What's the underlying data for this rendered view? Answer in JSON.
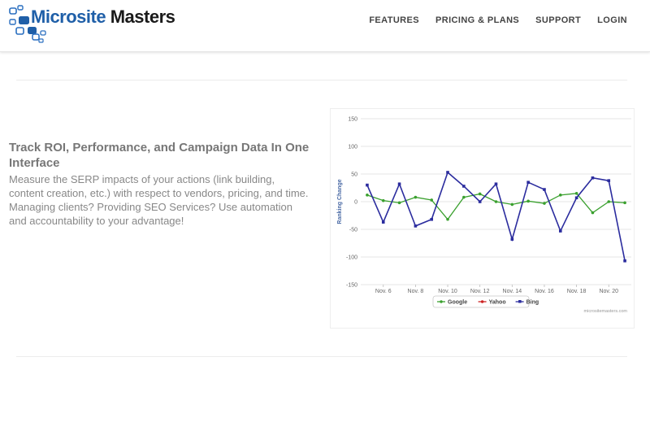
{
  "header": {
    "logo_word1": "Microsite",
    "logo_word2": "Masters",
    "nav": [
      "FEATURES",
      "PRICING & PLANS",
      "SUPPORT",
      "LOGIN"
    ]
  },
  "feature": {
    "title": "Track ROI, Performance, and Campaign Data In One Interface",
    "description": "Measure the SERP impacts of your actions (link building, content creation, etc.) with respect to vendors, pricing, and time. Managing clients? Providing SEO Services? Use automation and accountability to your advantage!"
  },
  "colors": {
    "google": "#3aa02e",
    "yahoo": "#cc2222",
    "bing": "#2b2c9e",
    "logo_blue": "#1f5fa8"
  },
  "chart_data": {
    "type": "line",
    "ylabel": "Ranking Change",
    "ylim": [
      -150,
      150
    ],
    "yticks": [
      150,
      100,
      50,
      0,
      -50,
      -100,
      -150
    ],
    "xticks": [
      "Nov. 6",
      "Nov. 8",
      "Nov. 10",
      "Nov. 12",
      "Nov. 14",
      "Nov. 16",
      "Nov. 18",
      "Nov. 20"
    ],
    "x_start_day": 5,
    "grid": true,
    "legend_position": "bottom",
    "credit": "micrositemasters.com",
    "series": [
      {
        "name": "Google",
        "color": "#3aa02e",
        "x": [
          5,
          6,
          7,
          8,
          9,
          10,
          11,
          12,
          13,
          14,
          15,
          16,
          17,
          18,
          19,
          20,
          21
        ],
        "values": [
          12,
          2,
          -2,
          8,
          3,
          -32,
          8,
          14,
          0,
          -5,
          1,
          -3,
          12,
          15,
          -20,
          0,
          -2
        ]
      },
      {
        "name": "Yahoo",
        "color": "#cc2222",
        "x": [],
        "values": []
      },
      {
        "name": "Bing",
        "color": "#2b2c9e",
        "x": [
          5,
          6,
          7,
          8,
          9,
          10,
          11,
          12,
          13,
          14,
          15,
          16,
          17,
          18,
          19,
          20,
          21
        ],
        "values": [
          30,
          -37,
          32,
          -44,
          -32,
          53,
          28,
          0,
          32,
          -68,
          35,
          22,
          -53,
          7,
          43,
          38,
          -107
        ]
      }
    ]
  }
}
